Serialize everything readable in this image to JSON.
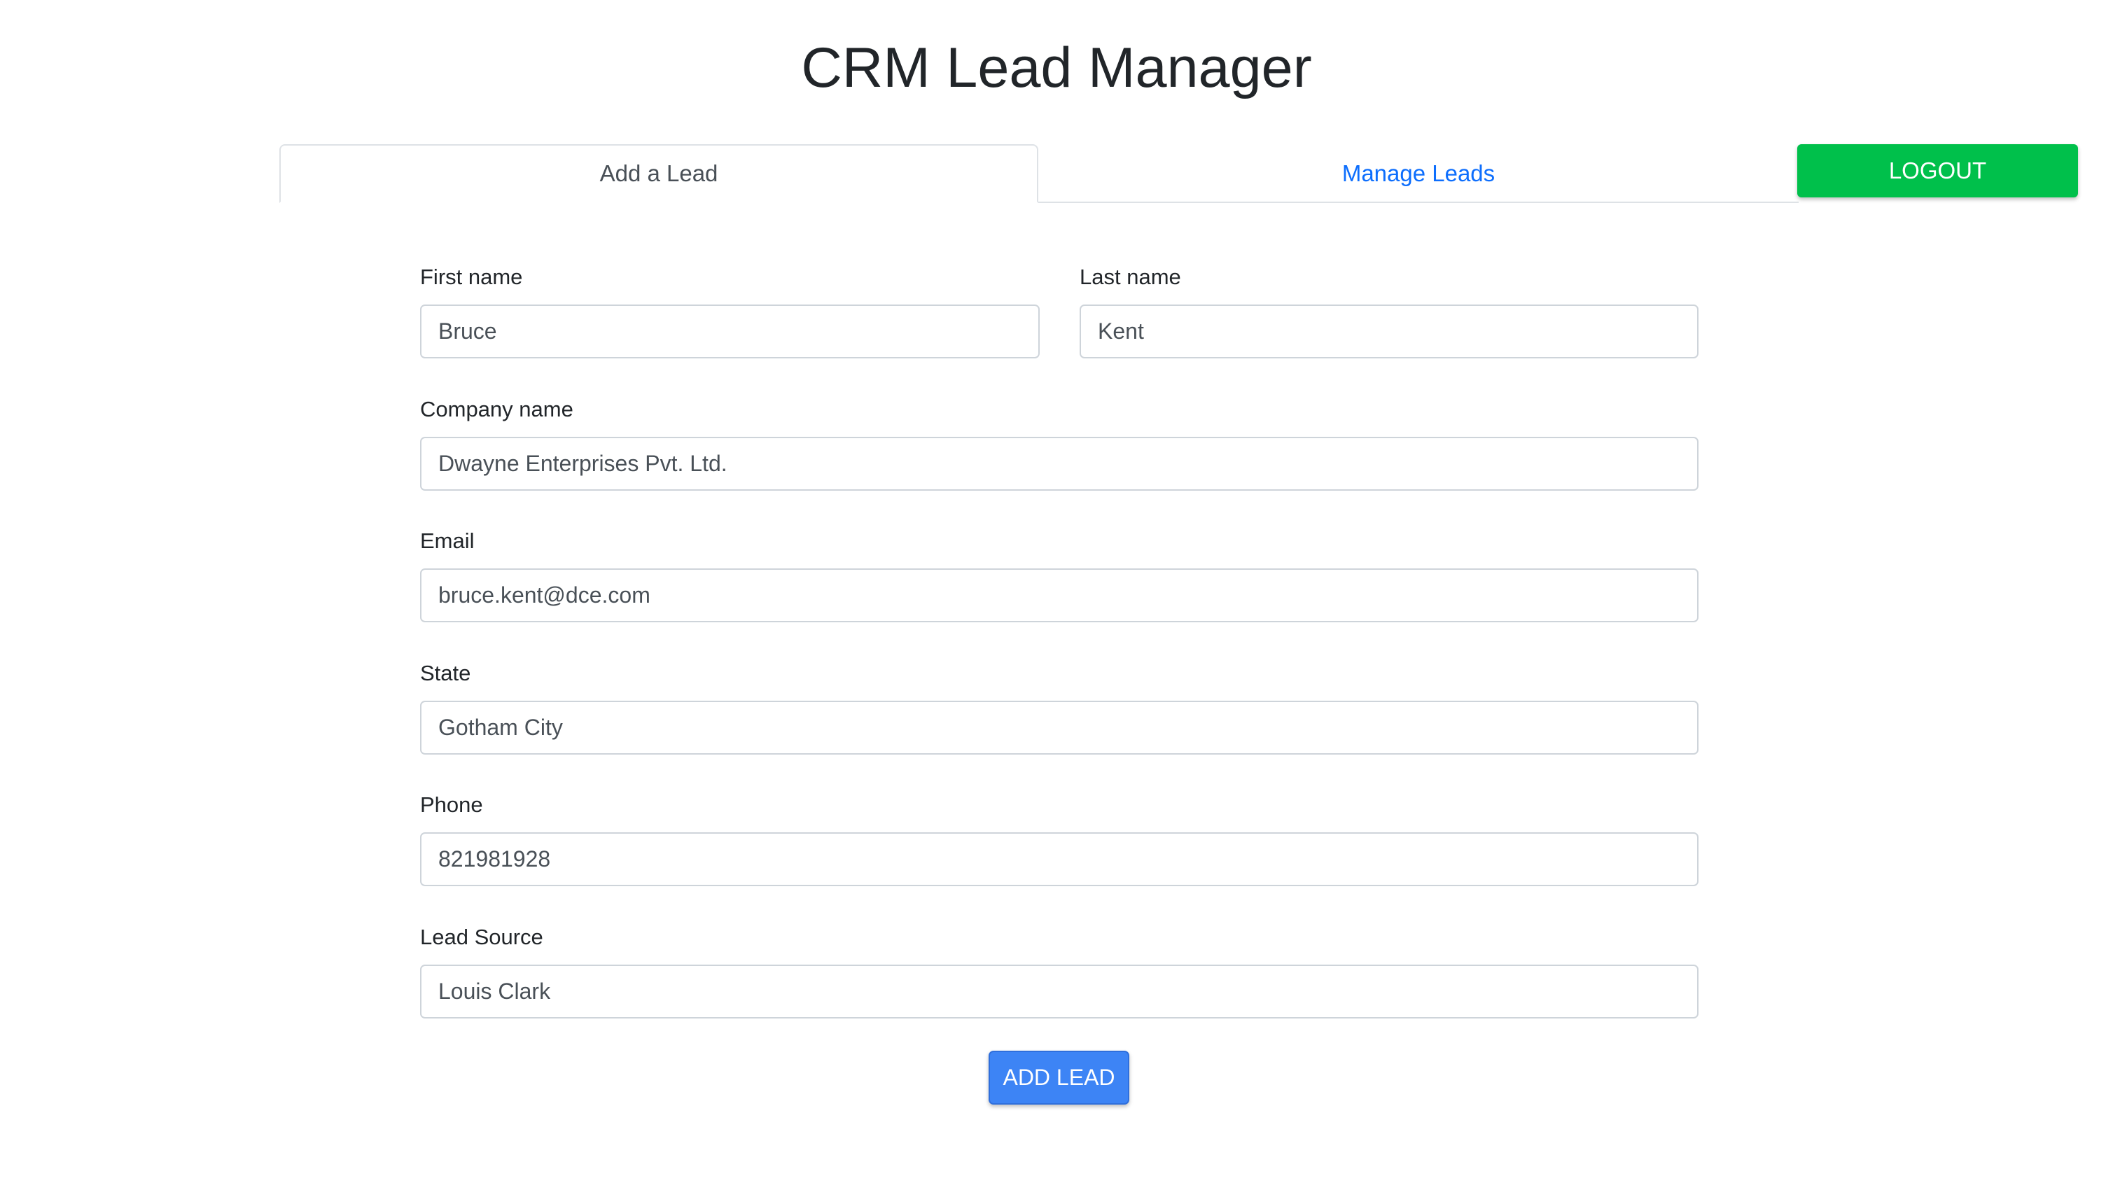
{
  "header": {
    "title": "CRM Lead Manager"
  },
  "tabs": [
    {
      "label": "Add a Lead",
      "active": true
    },
    {
      "label": "Manage Leads",
      "active": false
    }
  ],
  "logout_label": "LOGOUT",
  "form": {
    "first_name": {
      "label": "First name",
      "value": "Bruce"
    },
    "last_name": {
      "label": "Last name",
      "value": "Kent"
    },
    "company_name": {
      "label": "Company name",
      "value": "Dwayne Enterprises Pvt. Ltd."
    },
    "email": {
      "label": "Email",
      "value": "bruce.kent@dce.com"
    },
    "state": {
      "label": "State",
      "value": "Gotham City"
    },
    "phone": {
      "label": "Phone",
      "value": "821981928"
    },
    "lead_source": {
      "label": "Lead Source",
      "value": "Louis Clark"
    },
    "submit_label": "ADD LEAD"
  },
  "colors": {
    "logout_button": "#00c04b",
    "add_button": "#3d84f5",
    "active_link": "#0d6efd"
  }
}
